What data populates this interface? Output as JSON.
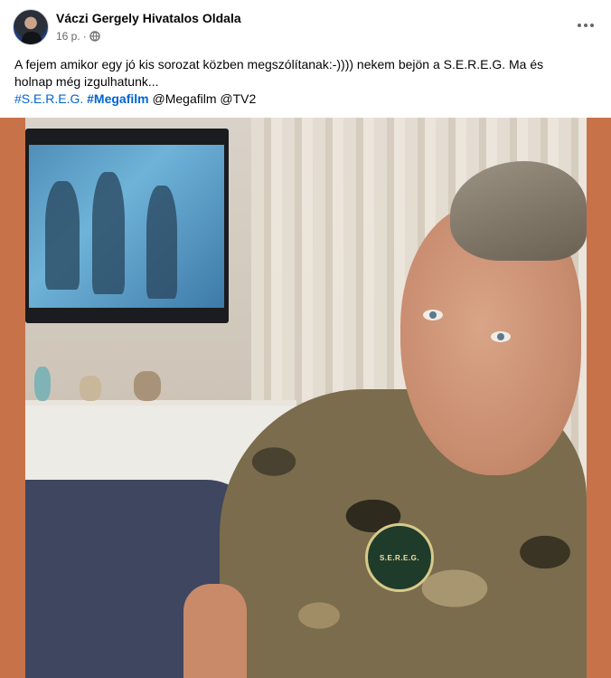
{
  "post": {
    "author": "Váczi Gergely Hivatalos Oldala",
    "time": "16 p.",
    "separator": "·",
    "privacy_icon": "globe-icon",
    "menu_icon": "more-horizontal-icon",
    "text_line1": "A fejem amikor egy jó kis sorozat közben megszólítanak:-)))) nekem bejön a S.E.R.E.G. Ma és",
    "text_line2": "holnap még izgulhatunk...",
    "tags": [
      {
        "text": "#S.E.R.E.G.",
        "kind": "hashtag"
      },
      {
        "text": "#Megafilm",
        "kind": "hashtag"
      },
      {
        "text": "@Megafilm",
        "kind": "mention"
      },
      {
        "text": "@TV2",
        "kind": "mention"
      }
    ]
  },
  "photo": {
    "badge_text": "S.E.R.E.G."
  },
  "colors": {
    "link": "#0064d1",
    "meta": "#65676b",
    "frame": "#c8724a"
  }
}
